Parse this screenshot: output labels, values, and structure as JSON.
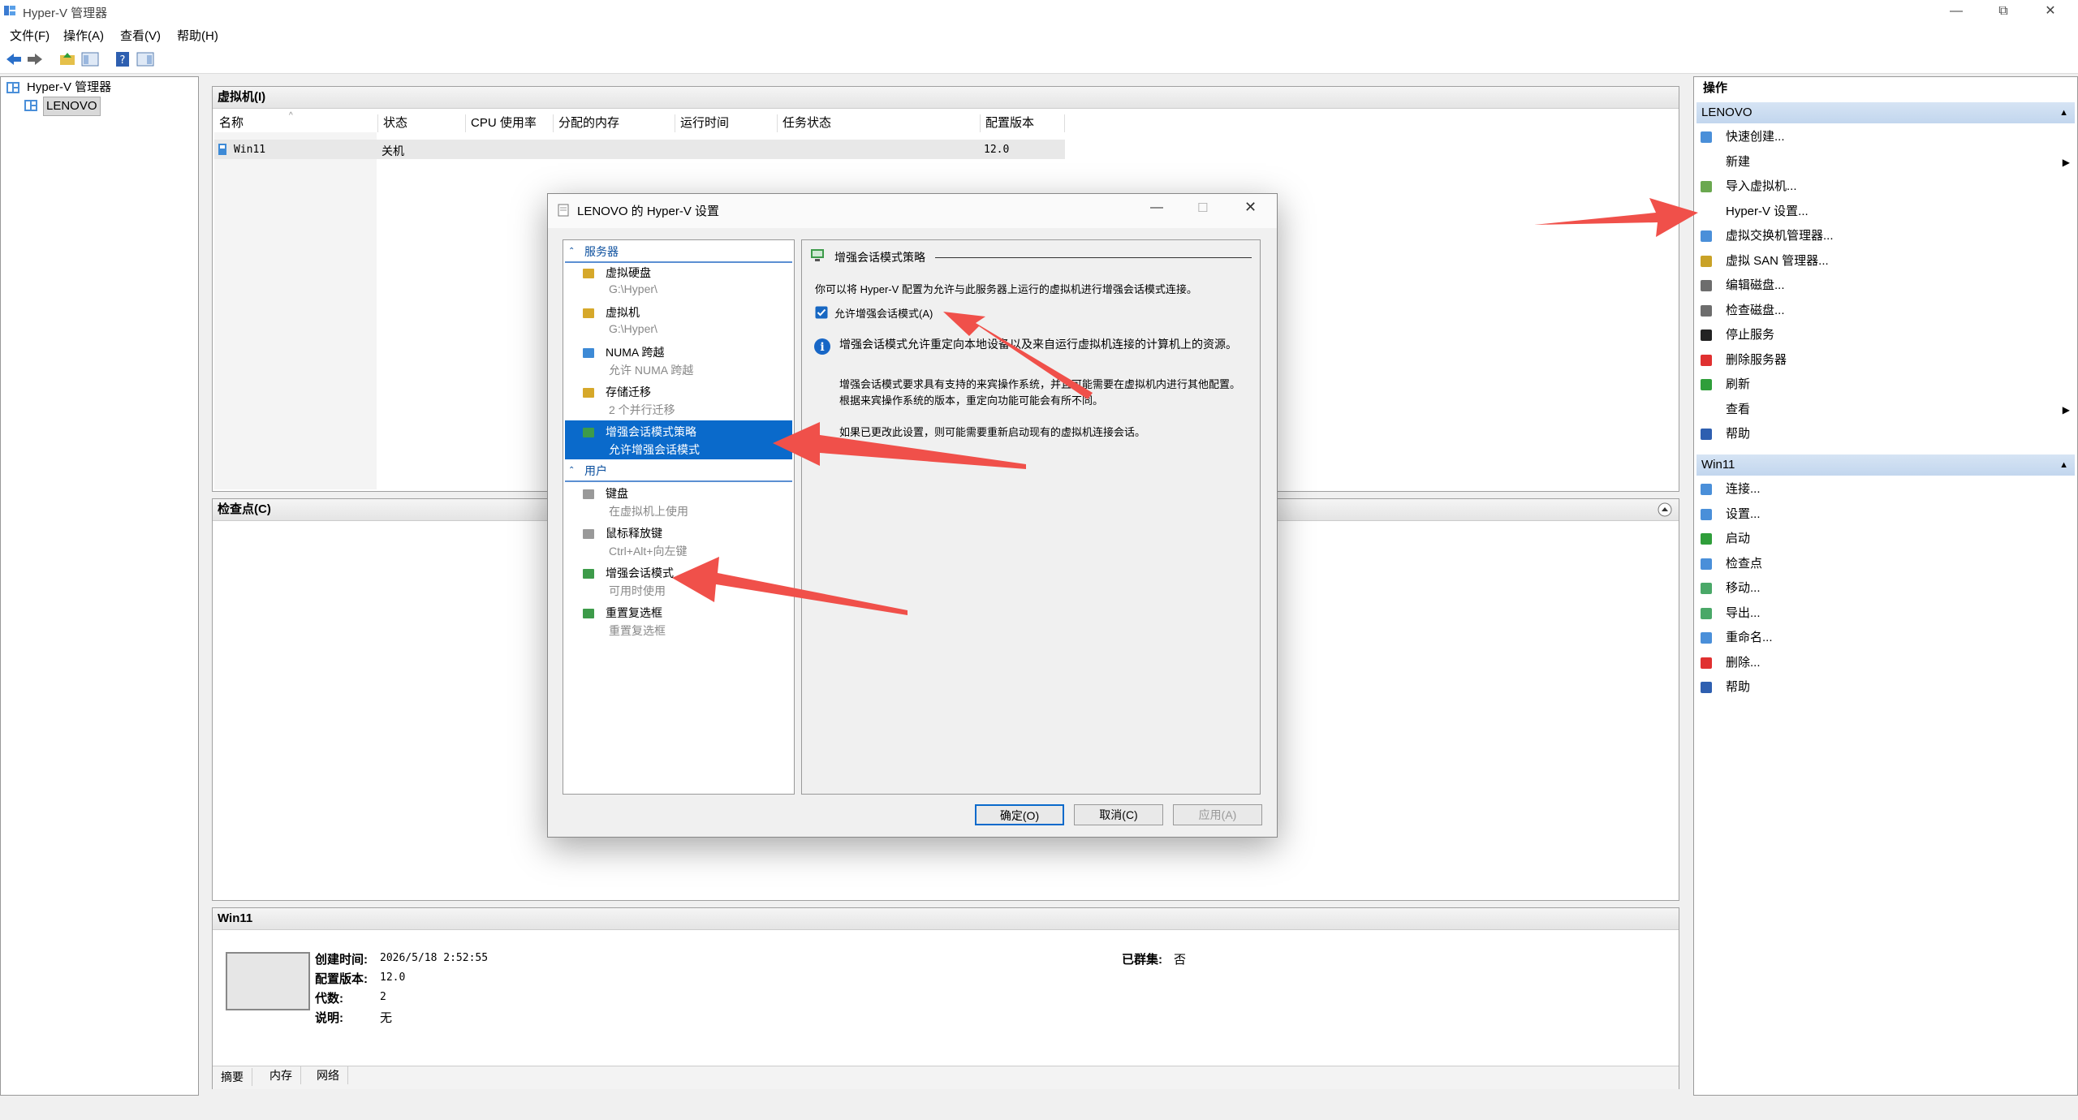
{
  "window": {
    "title": "Hyper-V 管理器",
    "controls": [
      "—",
      "⧉",
      "✕"
    ]
  },
  "menu": [
    "文件(F)",
    "操作(A)",
    "查看(V)",
    "帮助(H)"
  ],
  "tree": {
    "root": "Hyper-V 管理器",
    "child": "LENOVO"
  },
  "vms": {
    "title": "虚拟机(I)",
    "columns": [
      "名称",
      "状态",
      "CPU 使用率",
      "分配的内存",
      "运行时间",
      "任务状态",
      "配置版本"
    ],
    "rows": [
      {
        "name": "Win11",
        "state": "关机",
        "cpu": "",
        "memory": "",
        "uptime": "",
        "task": "",
        "version": "12.0"
      }
    ]
  },
  "checkpoints": {
    "title": "检查点(C)"
  },
  "details": {
    "title": "Win11",
    "created_label": "创建时间:",
    "created_value": "2026/5/18 2:52:55",
    "version_label": "配置版本:",
    "version_value": "12.0",
    "generation_label": "代数:",
    "generation_value": "2",
    "notes_label": "说明:",
    "notes_value": "无",
    "clustered_label": "已群集:",
    "clustered_value": "否",
    "tabs": [
      "摘要",
      "内存",
      "网络"
    ]
  },
  "actions": {
    "title": "操作",
    "lenovo_section": "LENOVO",
    "lenovo_items": [
      {
        "label": "快速创建...",
        "icon": "quick-create-icon",
        "submenu": false
      },
      {
        "label": "新建",
        "icon": "",
        "submenu": true
      },
      {
        "label": "导入虚拟机...",
        "icon": "import-icon",
        "submenu": false
      },
      {
        "label": "Hyper-V 设置...",
        "icon": "settings-page-icon",
        "submenu": false
      },
      {
        "label": "虚拟交换机管理器...",
        "icon": "switch-icon",
        "submenu": false
      },
      {
        "label": "虚拟 SAN 管理器...",
        "icon": "san-icon",
        "submenu": false
      },
      {
        "label": "编辑磁盘...",
        "icon": "edit-disk-icon",
        "submenu": false
      },
      {
        "label": "检查磁盘...",
        "icon": "inspect-disk-icon",
        "submenu": false
      },
      {
        "label": "停止服务",
        "icon": "stop-icon",
        "submenu": false
      },
      {
        "label": "删除服务器",
        "icon": "remove-icon",
        "submenu": false
      },
      {
        "label": "刷新",
        "icon": "refresh-icon",
        "submenu": false
      },
      {
        "label": "查看",
        "icon": "",
        "submenu": true
      },
      {
        "label": "帮助",
        "icon": "help-icon",
        "submenu": false
      }
    ],
    "vm_section": "Win11",
    "vm_items": [
      {
        "label": "连接...",
        "icon": "connect-icon"
      },
      {
        "label": "设置...",
        "icon": "settings-icon"
      },
      {
        "label": "启动",
        "icon": "start-icon"
      },
      {
        "label": "检查点",
        "icon": "checkpoint-icon"
      },
      {
        "label": "移动...",
        "icon": "move-icon"
      },
      {
        "label": "导出...",
        "icon": "export-icon"
      },
      {
        "label": "重命名...",
        "icon": "rename-icon"
      },
      {
        "label": "删除...",
        "icon": "delete-icon"
      },
      {
        "label": "帮助",
        "icon": "help-icon"
      }
    ]
  },
  "dialog": {
    "title": "LENOVO 的 Hyper-V 设置",
    "server_header": "服务器",
    "user_header": "用户",
    "server_items": [
      {
        "title": "虚拟硬盘",
        "sub": "G:\\Hyper\\"
      },
      {
        "title": "虚拟机",
        "sub": "G:\\Hyper\\"
      },
      {
        "title": "NUMA 跨越",
        "sub": "允许 NUMA 跨越"
      },
      {
        "title": "存储迁移",
        "sub": "2 个并行迁移"
      },
      {
        "title": "增强会话模式策略",
        "sub": "允许增强会话模式"
      }
    ],
    "user_items": [
      {
        "title": "键盘",
        "sub": "在虚拟机上使用"
      },
      {
        "title": "鼠标释放键",
        "sub": "Ctrl+Alt+向左键"
      },
      {
        "title": "增强会话模式",
        "sub": "可用时使用"
      },
      {
        "title": "重置复选框",
        "sub": "重置复选框"
      }
    ],
    "content": {
      "section_title": "增强会话模式策略",
      "description": "你可以将 Hyper-V 配置为允许与此服务器上运行的虚拟机进行增强会话模式连接。",
      "checkbox_label": "允许增强会话模式(A)",
      "checkbox_checked": true,
      "info1": "增强会话模式允许重定向本地设备以及来自运行虚拟机连接的计算机上的资源。",
      "info2": "增强会话模式要求具有支持的来宾操作系统，并且可能需要在虚拟机内进行其他配置。根据来宾操作系统的版本，重定向功能可能会有所不同。",
      "info3": "如果已更改此设置，则可能需要重新启动现有的虚拟机连接会话。"
    },
    "buttons": {
      "ok": "确定(O)",
      "cancel": "取消(C)",
      "apply": "应用(A)"
    }
  },
  "colors": {
    "selection": "#0a6acb",
    "section_header": "#c2d6ee",
    "annotation_arrow": "#f0504a"
  }
}
